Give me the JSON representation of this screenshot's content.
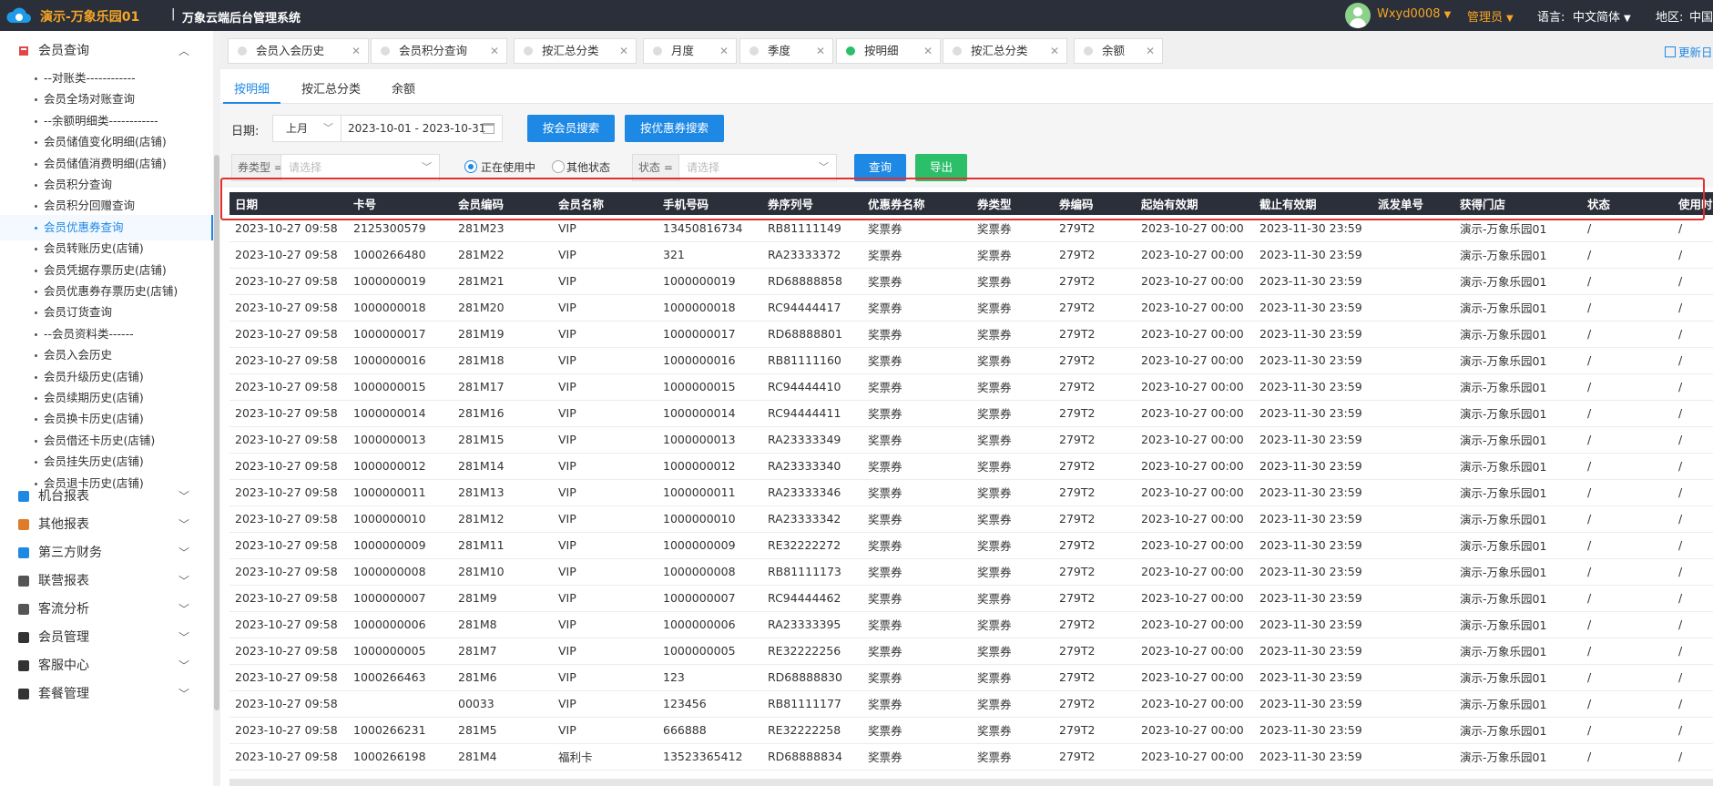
{
  "header": {
    "brand": "演示-万象乐园01",
    "separator": "|",
    "system_name": "万象云端后台管理系统",
    "user": "Wxyd0008",
    "role": "管理员",
    "language_label": "语言:",
    "language": "中文简体",
    "region_label": "地区:",
    "region": "中国"
  },
  "sidebar": {
    "open_group": "会员查询",
    "items": [
      "--对账类------------",
      "会员全场对账查询",
      "--余额明细类------------",
      "会员储值变化明细(店铺)",
      "会员储值消费明细(店铺)",
      "会员积分查询",
      "会员积分回赠查询",
      "会员优惠券查询",
      "会员转账历史(店铺)",
      "会员凭据存票历史(店铺)",
      "会员优惠券存票历史(店铺)",
      "会员订货查询",
      "--会员资料类------",
      "会员入会历史",
      "会员升级历史(店铺)",
      "会员续期历史(店铺)",
      "会员换卡历史(店铺)",
      "会员借还卡历史(店铺)",
      "会员挂失历史(店铺)",
      "会员退卡历史(店铺)"
    ],
    "groups": [
      "机台报表",
      "其他报表",
      "第三方财务",
      "联营报表",
      "客流分析",
      "会员管理",
      "客服中心",
      "套餐管理"
    ]
  },
  "tabs": [
    "会员入会历史",
    "会员积分查询",
    "按汇总分类",
    "月度",
    "季度",
    "按明细",
    "按汇总分类",
    "余额"
  ],
  "refresh_label": "更新日",
  "subtabs": [
    "按明细",
    "按汇总分类",
    "余额"
  ],
  "filters": {
    "date_label": "日期:",
    "period": "上月",
    "date_range": "2023-10-01 - 2023-10-31",
    "search_member_btn": "按会员搜索",
    "search_coupon_btn": "按优惠券搜索",
    "coupon_type_label": "券类型 =",
    "coupon_type_placeholder": "请选择",
    "radio_in_use": "正在使用中",
    "radio_other": "其他状态",
    "status_label": "状态 =",
    "status_placeholder": "请选择",
    "query_btn": "查询",
    "export_btn": "导出"
  },
  "table": {
    "columns": [
      "日期",
      "卡号",
      "会员编码",
      "会员名称",
      "手机号码",
      "券序列号",
      "优惠券名称",
      "券类型",
      "券编码",
      "起始有效期",
      "截止有效期",
      "派发单号",
      "获得门店",
      "状态",
      "使用时"
    ],
    "rows": [
      [
        "2023-10-27 09:58",
        "2125300579",
        "281M23",
        "VIP",
        "13450816734",
        "RB81111149",
        "奖票券",
        "奖票券",
        "279T2",
        "2023-10-27 00:00",
        "2023-11-30 23:59",
        "",
        "演示-万象乐园01",
        "/",
        "/"
      ],
      [
        "2023-10-27 09:58",
        "1000266480",
        "281M22",
        "VIP",
        "321",
        "RA23333372",
        "奖票券",
        "奖票券",
        "279T2",
        "2023-10-27 00:00",
        "2023-11-30 23:59",
        "",
        "演示-万象乐园01",
        "/",
        "/"
      ],
      [
        "2023-10-27 09:58",
        "1000000019",
        "281M21",
        "VIP",
        "1000000019",
        "RD68888858",
        "奖票券",
        "奖票券",
        "279T2",
        "2023-10-27 00:00",
        "2023-11-30 23:59",
        "",
        "演示-万象乐园01",
        "/",
        "/"
      ],
      [
        "2023-10-27 09:58",
        "1000000018",
        "281M20",
        "VIP",
        "1000000018",
        "RC94444417",
        "奖票券",
        "奖票券",
        "279T2",
        "2023-10-27 00:00",
        "2023-11-30 23:59",
        "",
        "演示-万象乐园01",
        "/",
        "/"
      ],
      [
        "2023-10-27 09:58",
        "1000000017",
        "281M19",
        "VIP",
        "1000000017",
        "RD68888801",
        "奖票券",
        "奖票券",
        "279T2",
        "2023-10-27 00:00",
        "2023-11-30 23:59",
        "",
        "演示-万象乐园01",
        "/",
        "/"
      ],
      [
        "2023-10-27 09:58",
        "1000000016",
        "281M18",
        "VIP",
        "1000000016",
        "RB81111160",
        "奖票券",
        "奖票券",
        "279T2",
        "2023-10-27 00:00",
        "2023-11-30 23:59",
        "",
        "演示-万象乐园01",
        "/",
        "/"
      ],
      [
        "2023-10-27 09:58",
        "1000000015",
        "281M17",
        "VIP",
        "1000000015",
        "RC94444410",
        "奖票券",
        "奖票券",
        "279T2",
        "2023-10-27 00:00",
        "2023-11-30 23:59",
        "",
        "演示-万象乐园01",
        "/",
        "/"
      ],
      [
        "2023-10-27 09:58",
        "1000000014",
        "281M16",
        "VIP",
        "1000000014",
        "RC94444411",
        "奖票券",
        "奖票券",
        "279T2",
        "2023-10-27 00:00",
        "2023-11-30 23:59",
        "",
        "演示-万象乐园01",
        "/",
        "/"
      ],
      [
        "2023-10-27 09:58",
        "1000000013",
        "281M15",
        "VIP",
        "1000000013",
        "RA23333349",
        "奖票券",
        "奖票券",
        "279T2",
        "2023-10-27 00:00",
        "2023-11-30 23:59",
        "",
        "演示-万象乐园01",
        "/",
        "/"
      ],
      [
        "2023-10-27 09:58",
        "1000000012",
        "281M14",
        "VIP",
        "1000000012",
        "RA23333340",
        "奖票券",
        "奖票券",
        "279T2",
        "2023-10-27 00:00",
        "2023-11-30 23:59",
        "",
        "演示-万象乐园01",
        "/",
        "/"
      ],
      [
        "2023-10-27 09:58",
        "1000000011",
        "281M13",
        "VIP",
        "1000000011",
        "RA23333346",
        "奖票券",
        "奖票券",
        "279T2",
        "2023-10-27 00:00",
        "2023-11-30 23:59",
        "",
        "演示-万象乐园01",
        "/",
        "/"
      ],
      [
        "2023-10-27 09:58",
        "1000000010",
        "281M12",
        "VIP",
        "1000000010",
        "RA23333342",
        "奖票券",
        "奖票券",
        "279T2",
        "2023-10-27 00:00",
        "2023-11-30 23:59",
        "",
        "演示-万象乐园01",
        "/",
        "/"
      ],
      [
        "2023-10-27 09:58",
        "1000000009",
        "281M11",
        "VIP",
        "1000000009",
        "RE32222272",
        "奖票券",
        "奖票券",
        "279T2",
        "2023-10-27 00:00",
        "2023-11-30 23:59",
        "",
        "演示-万象乐园01",
        "/",
        "/"
      ],
      [
        "2023-10-27 09:58",
        "1000000008",
        "281M10",
        "VIP",
        "1000000008",
        "RB81111173",
        "奖票券",
        "奖票券",
        "279T2",
        "2023-10-27 00:00",
        "2023-11-30 23:59",
        "",
        "演示-万象乐园01",
        "/",
        "/"
      ],
      [
        "2023-10-27 09:58",
        "1000000007",
        "281M9",
        "VIP",
        "1000000007",
        "RC94444462",
        "奖票券",
        "奖票券",
        "279T2",
        "2023-10-27 00:00",
        "2023-11-30 23:59",
        "",
        "演示-万象乐园01",
        "/",
        "/"
      ],
      [
        "2023-10-27 09:58",
        "1000000006",
        "281M8",
        "VIP",
        "1000000006",
        "RA23333395",
        "奖票券",
        "奖票券",
        "279T2",
        "2023-10-27 00:00",
        "2023-11-30 23:59",
        "",
        "演示-万象乐园01",
        "/",
        "/"
      ],
      [
        "2023-10-27 09:58",
        "1000000005",
        "281M7",
        "VIP",
        "1000000005",
        "RE32222256",
        "奖票券",
        "奖票券",
        "279T2",
        "2023-10-27 00:00",
        "2023-11-30 23:59",
        "",
        "演示-万象乐园01",
        "/",
        "/"
      ],
      [
        "2023-10-27 09:58",
        "1000266463",
        "281M6",
        "VIP",
        "123",
        "RD68888830",
        "奖票券",
        "奖票券",
        "279T2",
        "2023-10-27 00:00",
        "2023-11-30 23:59",
        "",
        "演示-万象乐园01",
        "/",
        "/"
      ],
      [
        "2023-10-27 09:58",
        "",
        "00033",
        "VIP",
        "123456",
        "RB81111177",
        "奖票券",
        "奖票券",
        "279T2",
        "2023-10-27 00:00",
        "2023-11-30 23:59",
        "",
        "演示-万象乐园01",
        "/",
        "/"
      ],
      [
        "2023-10-27 09:58",
        "1000266231",
        "281M5",
        "VIP",
        "666888",
        "RE32222258",
        "奖票券",
        "奖票券",
        "279T2",
        "2023-10-27 00:00",
        "2023-11-30 23:59",
        "",
        "演示-万象乐园01",
        "/",
        "/"
      ],
      [
        "2023-10-27 09:58",
        "1000266198",
        "281M4",
        "福利卡",
        "13523365412",
        "RD68888834",
        "奖票券",
        "奖票券",
        "279T2",
        "2023-10-27 00:00",
        "2023-11-30 23:59",
        "",
        "演示-万象乐园01",
        "/",
        "/"
      ]
    ]
  },
  "colors": {
    "topbar": "#2b2f3a",
    "brand": "#f5a623",
    "accent": "#1e88e5",
    "success": "#2bbf6a",
    "highlight": "#e03030"
  }
}
